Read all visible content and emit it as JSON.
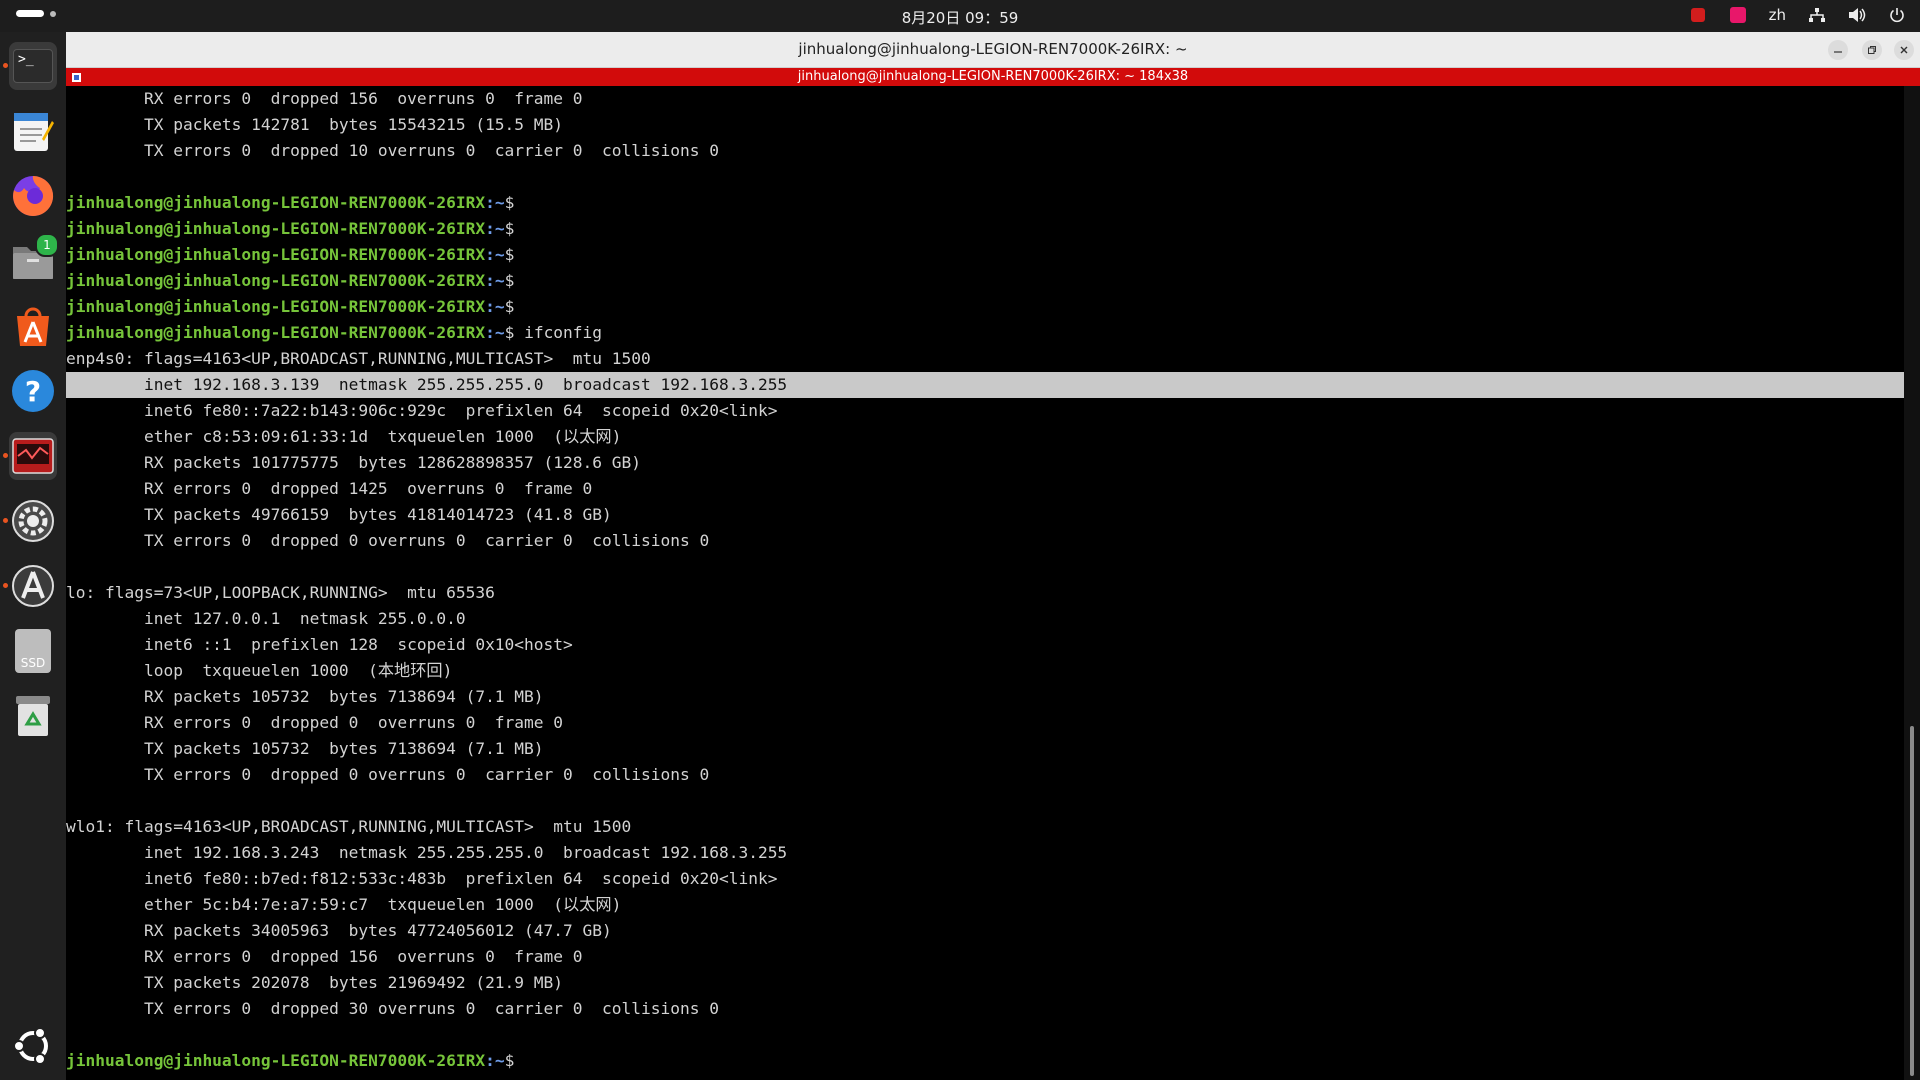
{
  "topbar": {
    "clock": "8月20日  09：59",
    "lang": "zh"
  },
  "dock": {
    "items": [
      {
        "name": "terminal",
        "icon": ">_",
        "active": true,
        "running": true
      },
      {
        "name": "text-editor"
      },
      {
        "name": "firefox"
      },
      {
        "name": "files",
        "badge": "1"
      },
      {
        "name": "app-center"
      },
      {
        "name": "help",
        "icon": "?"
      },
      {
        "name": "system-monitor",
        "active": true,
        "running": true
      },
      {
        "name": "settings",
        "running": true
      },
      {
        "name": "software-updater",
        "running": true
      },
      {
        "name": "ssd-drive",
        "icon": "SSD"
      },
      {
        "name": "trash"
      },
      {
        "name": "show-apps"
      }
    ]
  },
  "window": {
    "title": "jinhualong@jinhualong-LEGION-REN7000K-26IRX: ~",
    "infobar": "jinhualong@jinhualong-LEGION-REN7000K-26IRX: ~ 184x38"
  },
  "terminal": {
    "user": "jinhualong@jinhualong-LEGION-REN7000K-26IRX",
    "path": ":~",
    "lines": [
      {
        "t": "        RX errors 0  dropped 156  overruns 0  frame 0"
      },
      {
        "t": "        TX packets 142781  bytes 15543215 (15.5 MB)"
      },
      {
        "t": "        TX errors 0  dropped 10 overruns 0  carrier 0  collisions 0"
      },
      {
        "t": ""
      },
      {
        "p": true,
        "cmd": ""
      },
      {
        "p": true,
        "cmd": ""
      },
      {
        "p": true,
        "cmd": ""
      },
      {
        "p": true,
        "cmd": ""
      },
      {
        "p": true,
        "cmd": ""
      },
      {
        "p": true,
        "cmd": " ifconfig"
      },
      {
        "t": "enp4s0: flags=4163<UP,BROADCAST,RUNNING,MULTICAST>  mtu 1500"
      },
      {
        "t": "        inet 192.168.3.139  netmask 255.255.255.0  broadcast 192.168.3.255",
        "hl": true
      },
      {
        "t": "        inet6 fe80::7a22:b143:906c:929c  prefixlen 64  scopeid 0x20<link>"
      },
      {
        "t": "        ether c8:53:09:61:33:1d  txqueuelen 1000  (以太网)"
      },
      {
        "t": "        RX packets 101775775  bytes 128628898357 (128.6 GB)"
      },
      {
        "t": "        RX errors 0  dropped 1425  overruns 0  frame 0"
      },
      {
        "t": "        TX packets 49766159  bytes 41814014723 (41.8 GB)"
      },
      {
        "t": "        TX errors 0  dropped 0 overruns 0  carrier 0  collisions 0"
      },
      {
        "t": ""
      },
      {
        "t": "lo: flags=73<UP,LOOPBACK,RUNNING>  mtu 65536"
      },
      {
        "t": "        inet 127.0.0.1  netmask 255.0.0.0"
      },
      {
        "t": "        inet6 ::1  prefixlen 128  scopeid 0x10<host>"
      },
      {
        "t": "        loop  txqueuelen 1000  (本地环回)"
      },
      {
        "t": "        RX packets 105732  bytes 7138694 (7.1 MB)"
      },
      {
        "t": "        RX errors 0  dropped 0  overruns 0  frame 0"
      },
      {
        "t": "        TX packets 105732  bytes 7138694 (7.1 MB)"
      },
      {
        "t": "        TX errors 0  dropped 0 overruns 0  carrier 0  collisions 0"
      },
      {
        "t": ""
      },
      {
        "t": "wlo1: flags=4163<UP,BROADCAST,RUNNING,MULTICAST>  mtu 1500"
      },
      {
        "t": "        inet 192.168.3.243  netmask 255.255.255.0  broadcast 192.168.3.255"
      },
      {
        "t": "        inet6 fe80::b7ed:f812:533c:483b  prefixlen 64  scopeid 0x20<link>"
      },
      {
        "t": "        ether 5c:b4:7e:a7:59:c7  txqueuelen 1000  (以太网)"
      },
      {
        "t": "        RX packets 34005963  bytes 47724056012 (47.7 GB)"
      },
      {
        "t": "        RX errors 0  dropped 156  overruns 0  frame 0"
      },
      {
        "t": "        TX packets 202078  bytes 21969492 (21.9 MB)"
      },
      {
        "t": "        TX errors 0  dropped 30 overruns 0  carrier 0  collisions 0"
      },
      {
        "t": ""
      },
      {
        "p": true,
        "cmd": ""
      }
    ]
  }
}
